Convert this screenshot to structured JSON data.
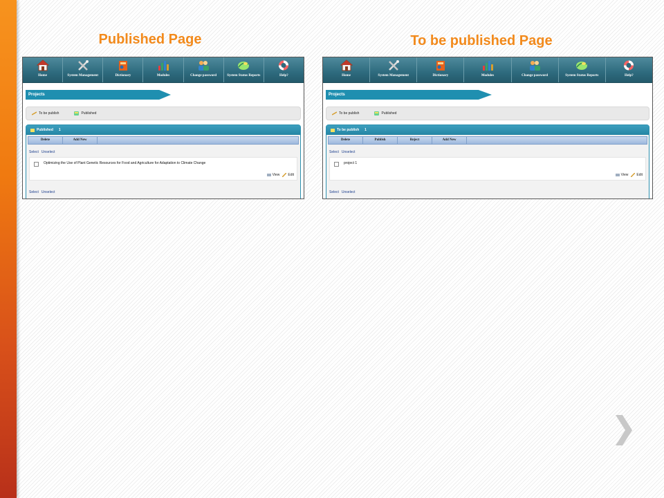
{
  "titles": {
    "left": "Published Page",
    "right": "To be published Page"
  },
  "navbar": [
    {
      "label": "Home",
      "icon": "home-icon"
    },
    {
      "label": "System Management",
      "icon": "tools-icon"
    },
    {
      "label": "Dictionary",
      "icon": "book-icon"
    },
    {
      "label": "Modules",
      "icon": "chart-icon"
    },
    {
      "label": "Change password",
      "icon": "users-icon"
    },
    {
      "label": "System Status Reports",
      "icon": "report-icon"
    },
    {
      "label": "Help?",
      "icon": "lifebuoy-icon"
    }
  ],
  "left_panel": {
    "section": "Projects",
    "filters": {
      "to_publish": "To be publish",
      "published": "Published"
    },
    "list_title": "Published",
    "list_count": "1",
    "buttons": [
      "Delete",
      "Add New"
    ],
    "select": "Select",
    "unselect": "Unselect",
    "item": "Optimizing the Use of Plant Genetic Resources for Food and Agriculture for Adaptation to Climate Change",
    "view": "View",
    "edit": "Edit"
  },
  "right_panel": {
    "section": "Projects",
    "filters": {
      "to_publish": "To be publish",
      "published": "Published"
    },
    "list_title": "To be publish",
    "list_count": "1",
    "buttons": [
      "Delete",
      "Publish",
      "Reject",
      "Add New"
    ],
    "select": "Select",
    "unselect": "Unselect",
    "item": "project 1",
    "view": "View",
    "edit": "Edit"
  },
  "colors": {
    "accent_orange": "#f28a1c",
    "nav_teal": "#2e6b7e",
    "ribbon_blue": "#1f8fb0"
  }
}
